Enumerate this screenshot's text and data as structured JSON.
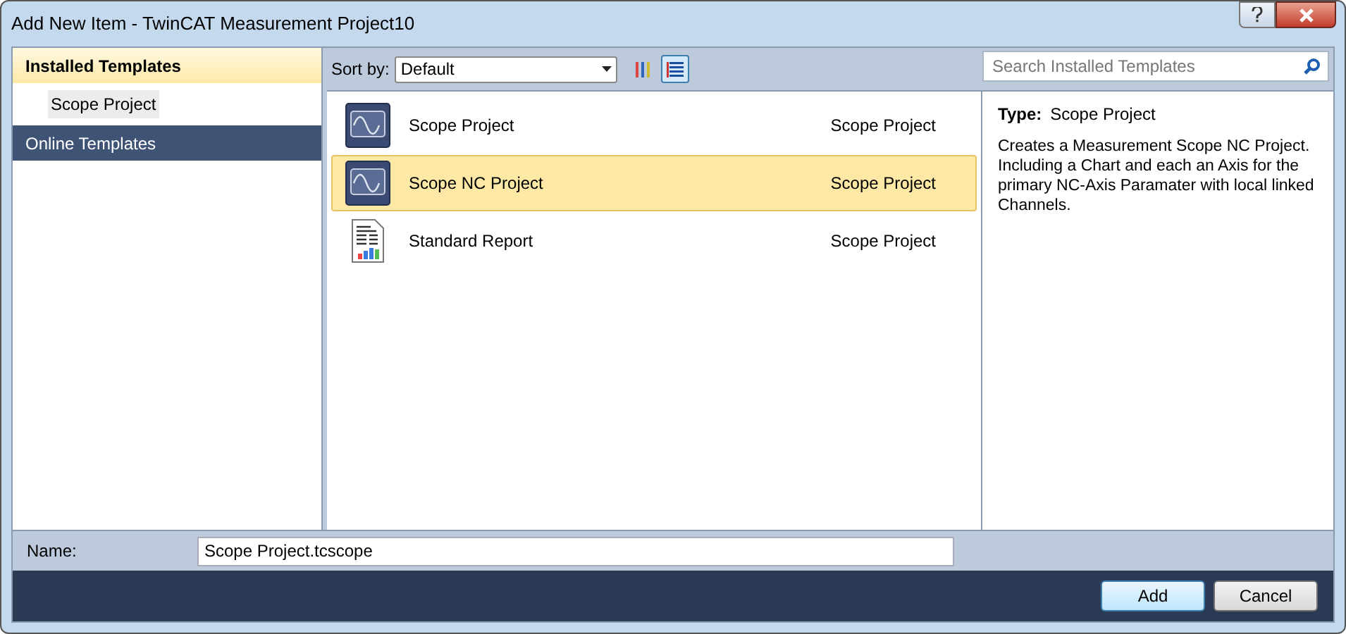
{
  "window": {
    "title": "Add New Item - TwinCAT Measurement Project10"
  },
  "sidebar": {
    "items": [
      {
        "label": "Installed Templates",
        "kind": "header",
        "selected": true
      },
      {
        "label": "Scope Project",
        "kind": "item",
        "selected": true
      },
      {
        "label": "Online Templates",
        "kind": "header",
        "selected": false
      }
    ]
  },
  "toolbar": {
    "sort_label": "Sort by:",
    "sort_value": "Default",
    "view_buttons": [
      {
        "kind": "small",
        "selected": false
      },
      {
        "kind": "list",
        "selected": true
      }
    ]
  },
  "search": {
    "placeholder": "Search Installed Templates"
  },
  "templates": [
    {
      "name": "Scope Project",
      "type": "Scope Project",
      "kind": "scope",
      "selected": false
    },
    {
      "name": "Scope NC Project",
      "type": "Scope Project",
      "kind": "scope",
      "selected": true
    },
    {
      "name": "Standard Report",
      "type": "Scope Project",
      "kind": "report",
      "selected": false
    }
  ],
  "details": {
    "type_label": "Type:",
    "type_value": "Scope Project",
    "description": "Creates a Measurement Scope NC Project. Including a Chart and each an Axis for the primary NC-Axis Paramater with local linked Channels."
  },
  "name_field": {
    "label": "Name:",
    "value": "Scope Project.tcscope"
  },
  "buttons": [
    {
      "label": "Add",
      "default": true
    },
    {
      "label": "Cancel",
      "default": false
    }
  ]
}
